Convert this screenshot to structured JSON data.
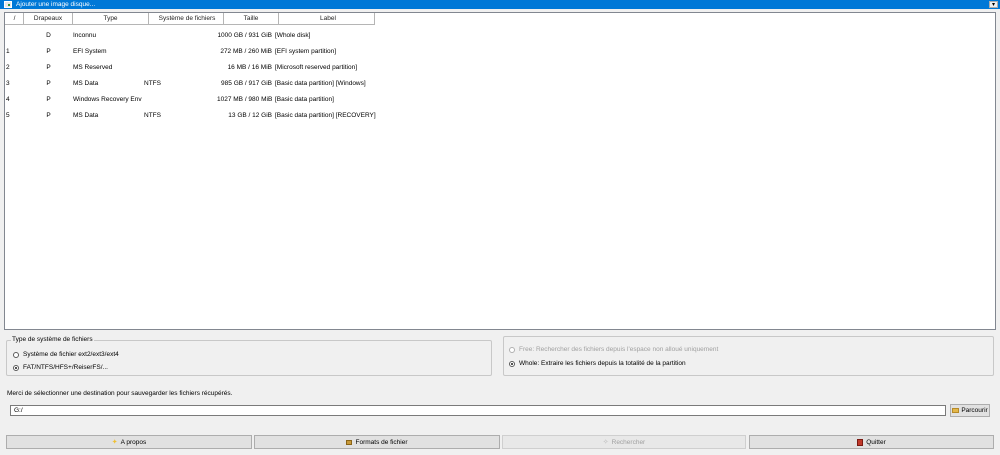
{
  "window": {
    "combo_text": "Ajouter une image disque..."
  },
  "table": {
    "headers": {
      "num": "/",
      "flags": "Drapeaux",
      "type": "Type",
      "fs": "Système de fichiers",
      "size": "Taille",
      "label": "Label"
    },
    "rows": [
      {
        "num": "",
        "flags": "D",
        "type": "Inconnu",
        "fs": "",
        "size": "1000 GB / 931 GiB",
        "label": "[Whole disk]"
      },
      {
        "num": "1",
        "flags": "P",
        "type": "EFI System",
        "fs": "",
        "size": "272 MB / 260 MiB",
        "label": "[EFI system partition]"
      },
      {
        "num": "2",
        "flags": "P",
        "type": "MS Reserved",
        "fs": "",
        "size": "16 MB / 16 MiB",
        "label": "[Microsoft reserved partition]"
      },
      {
        "num": "3",
        "flags": "P",
        "type": "MS Data",
        "fs": "NTFS",
        "size": "985 GB / 917 GiB",
        "label": "[Basic data partition] [Windows]"
      },
      {
        "num": "4",
        "flags": "P",
        "type": "Windows Recovery Env",
        "fs": "",
        "size": "1027 MB / 980 MiB",
        "label": "[Basic data partition]"
      },
      {
        "num": "5",
        "flags": "P",
        "type": "MS Data",
        "fs": "NTFS",
        "size": "13 GB / 12 GiB",
        "label": "[Basic data partition] [RECOVERY]"
      }
    ]
  },
  "fs_group": {
    "title": "Type de système de fichiers",
    "options": [
      {
        "label": "Système de fichier ext2/ext3/ext4",
        "checked": false
      },
      {
        "label": "FAT/NTFS/HFS+/ReiserFS/...",
        "checked": true
      }
    ]
  },
  "mode_group": {
    "options": [
      {
        "label": "Free: Rechercher des fichiers depuis l'espace non alloué uniquement",
        "checked": false,
        "disabled": true
      },
      {
        "label": "Whole: Extraire les fichiers depuis la totalité de la partition",
        "checked": true,
        "disabled": false
      }
    ]
  },
  "destination": {
    "label": "Merci de sélectionner une destination pour sauvegarder les fichiers récupérés.",
    "value": "G:/",
    "browse_label": "Parcourir"
  },
  "buttons": {
    "about": "A propos",
    "formats": "Formats de fichier",
    "search": "Rechercher",
    "quit": "Quitter"
  }
}
